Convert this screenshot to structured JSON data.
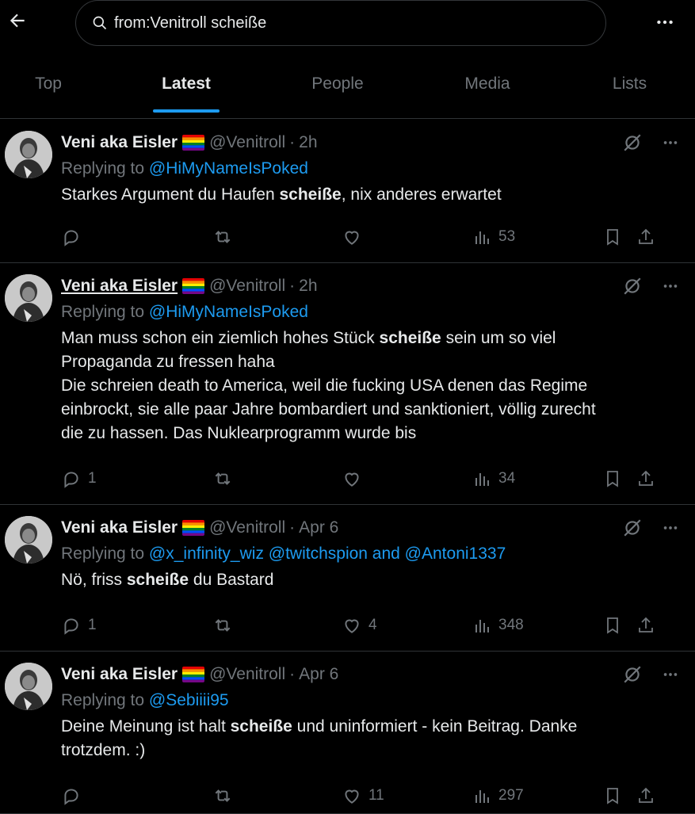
{
  "search": {
    "query": "from:Venitroll scheiße"
  },
  "tabs": [
    {
      "label": "Top"
    },
    {
      "label": "Latest"
    },
    {
      "label": "People"
    },
    {
      "label": "Media"
    },
    {
      "label": "Lists"
    }
  ],
  "active_tab": "Latest",
  "colors": {
    "background": "#000000",
    "accent": "#1d9bf0",
    "muted": "#71767b",
    "text": "#e7e9ea"
  },
  "tweets": [
    {
      "name": "Veni aka Eisler",
      "flag": "rainbow-flag",
      "handle": "@Venitroll",
      "separator": "·",
      "time": "2h",
      "replying_to_prefix": "Replying to",
      "mentions": "@HiMyNameIsPoked",
      "text_before": "Starkes Argument du Haufen ",
      "text_bold": "scheiße",
      "text_after": ", nix anderes erwartet",
      "replies": "",
      "reposts": "",
      "likes": "",
      "views": "53"
    },
    {
      "name": "Veni aka Eisler",
      "flag": "rainbow-flag",
      "handle": "@Venitroll",
      "separator": "·",
      "time": "2h",
      "replying_to_prefix": "Replying to",
      "mentions": "@HiMyNameIsPoked",
      "text_before": "Man muss schon ein ziemlich hohes Stück ",
      "text_bold": "scheiße",
      "text_after": " sein um so viel\nPropaganda zu fressen haha\nDie schreien death to America, weil die fucking USA denen das Regime\neinbrockt, sie alle paar Jahre bombardiert und sanktioniert, völlig zurecht\ndie zu hassen. Das Nuklearprogramm wurde bis",
      "replies": "1",
      "reposts": "",
      "likes": "",
      "views": "34"
    },
    {
      "name": "Veni aka Eisler",
      "flag": "rainbow-flag",
      "handle": "@Venitroll",
      "separator": "·",
      "time": "Apr 6",
      "replying_to_prefix": "Replying to",
      "mentions": "@x_infinity_wiz @twitchspion and @Antoni1337",
      "text_before": "Nö, friss ",
      "text_bold": "scheiße",
      "text_after": " du Bastard",
      "replies": "1",
      "reposts": "",
      "likes": "4",
      "views": "348"
    },
    {
      "name": "Veni aka Eisler",
      "flag": "rainbow-flag",
      "handle": "@Venitroll",
      "separator": "·",
      "time": "Apr 6",
      "replying_to_prefix": "Replying to",
      "mentions": "@Sebiiii95",
      "text_before": "Deine Meinung ist halt ",
      "text_bold": "scheiße",
      "text_after": " und uninformiert - kein Beitrag. Danke\ntrotzdem. :)",
      "replies": "",
      "reposts": "",
      "likes": "11",
      "views": "297"
    }
  ]
}
